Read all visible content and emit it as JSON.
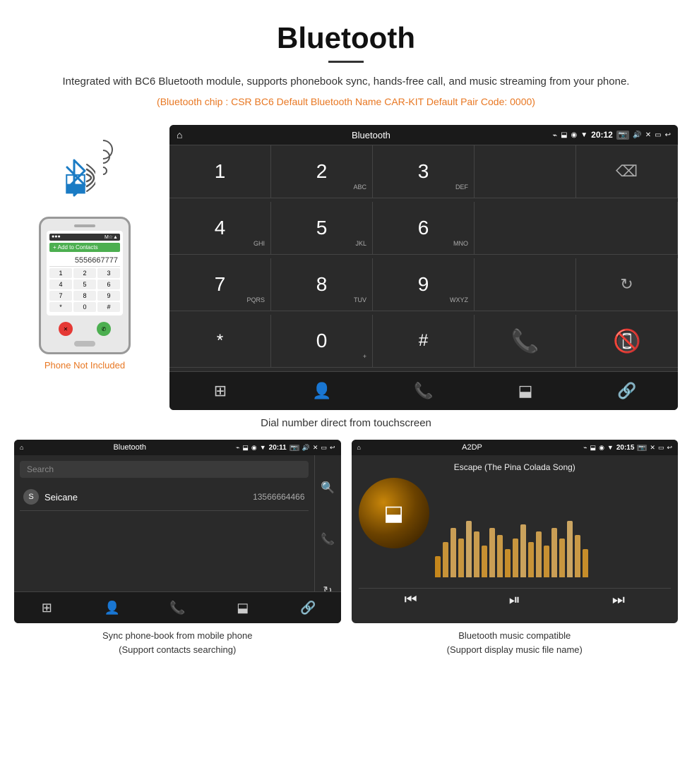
{
  "header": {
    "title": "Bluetooth",
    "description": "Integrated with BC6 Bluetooth module, supports phonebook sync, hands-free call, and music streaming from your phone.",
    "specs": "(Bluetooth chip : CSR BC6    Default Bluetooth Name CAR-KIT    Default Pair Code: 0000)"
  },
  "phone_not_included": "Phone Not Included",
  "main_caption": "Dial number direct from touchscreen",
  "dialpad": {
    "screen_title": "Bluetooth",
    "time": "20:12",
    "keys": [
      {
        "num": "1",
        "sub": ""
      },
      {
        "num": "2",
        "sub": "ABC"
      },
      {
        "num": "3",
        "sub": "DEF"
      },
      {
        "num": "4",
        "sub": "GHI"
      },
      {
        "num": "5",
        "sub": "JKL"
      },
      {
        "num": "6",
        "sub": "MNO"
      },
      {
        "num": "7",
        "sub": "PQRS"
      },
      {
        "num": "8",
        "sub": "TUV"
      },
      {
        "num": "9",
        "sub": "WXYZ"
      },
      {
        "num": "*",
        "sub": ""
      },
      {
        "num": "0",
        "sub": "+"
      },
      {
        "num": "#",
        "sub": ""
      }
    ]
  },
  "phonebook": {
    "screen_title": "Bluetooth",
    "time": "20:11",
    "search_placeholder": "Search",
    "contacts": [
      {
        "letter": "S",
        "name": "Seicane",
        "number": "13566664466"
      }
    ],
    "caption_line1": "Sync phone-book from mobile phone",
    "caption_line2": "(Support contacts searching)"
  },
  "music": {
    "screen_title": "A2DP",
    "time": "20:15",
    "song_title": "Escape (The Pina Colada Song)",
    "eq_bars": [
      30,
      50,
      70,
      55,
      80,
      65,
      45,
      70,
      60,
      40,
      55,
      75,
      50,
      65,
      45,
      70,
      55,
      80,
      60,
      40
    ],
    "caption_line1": "Bluetooth music compatible",
    "caption_line2": "(Support display music file name)"
  }
}
